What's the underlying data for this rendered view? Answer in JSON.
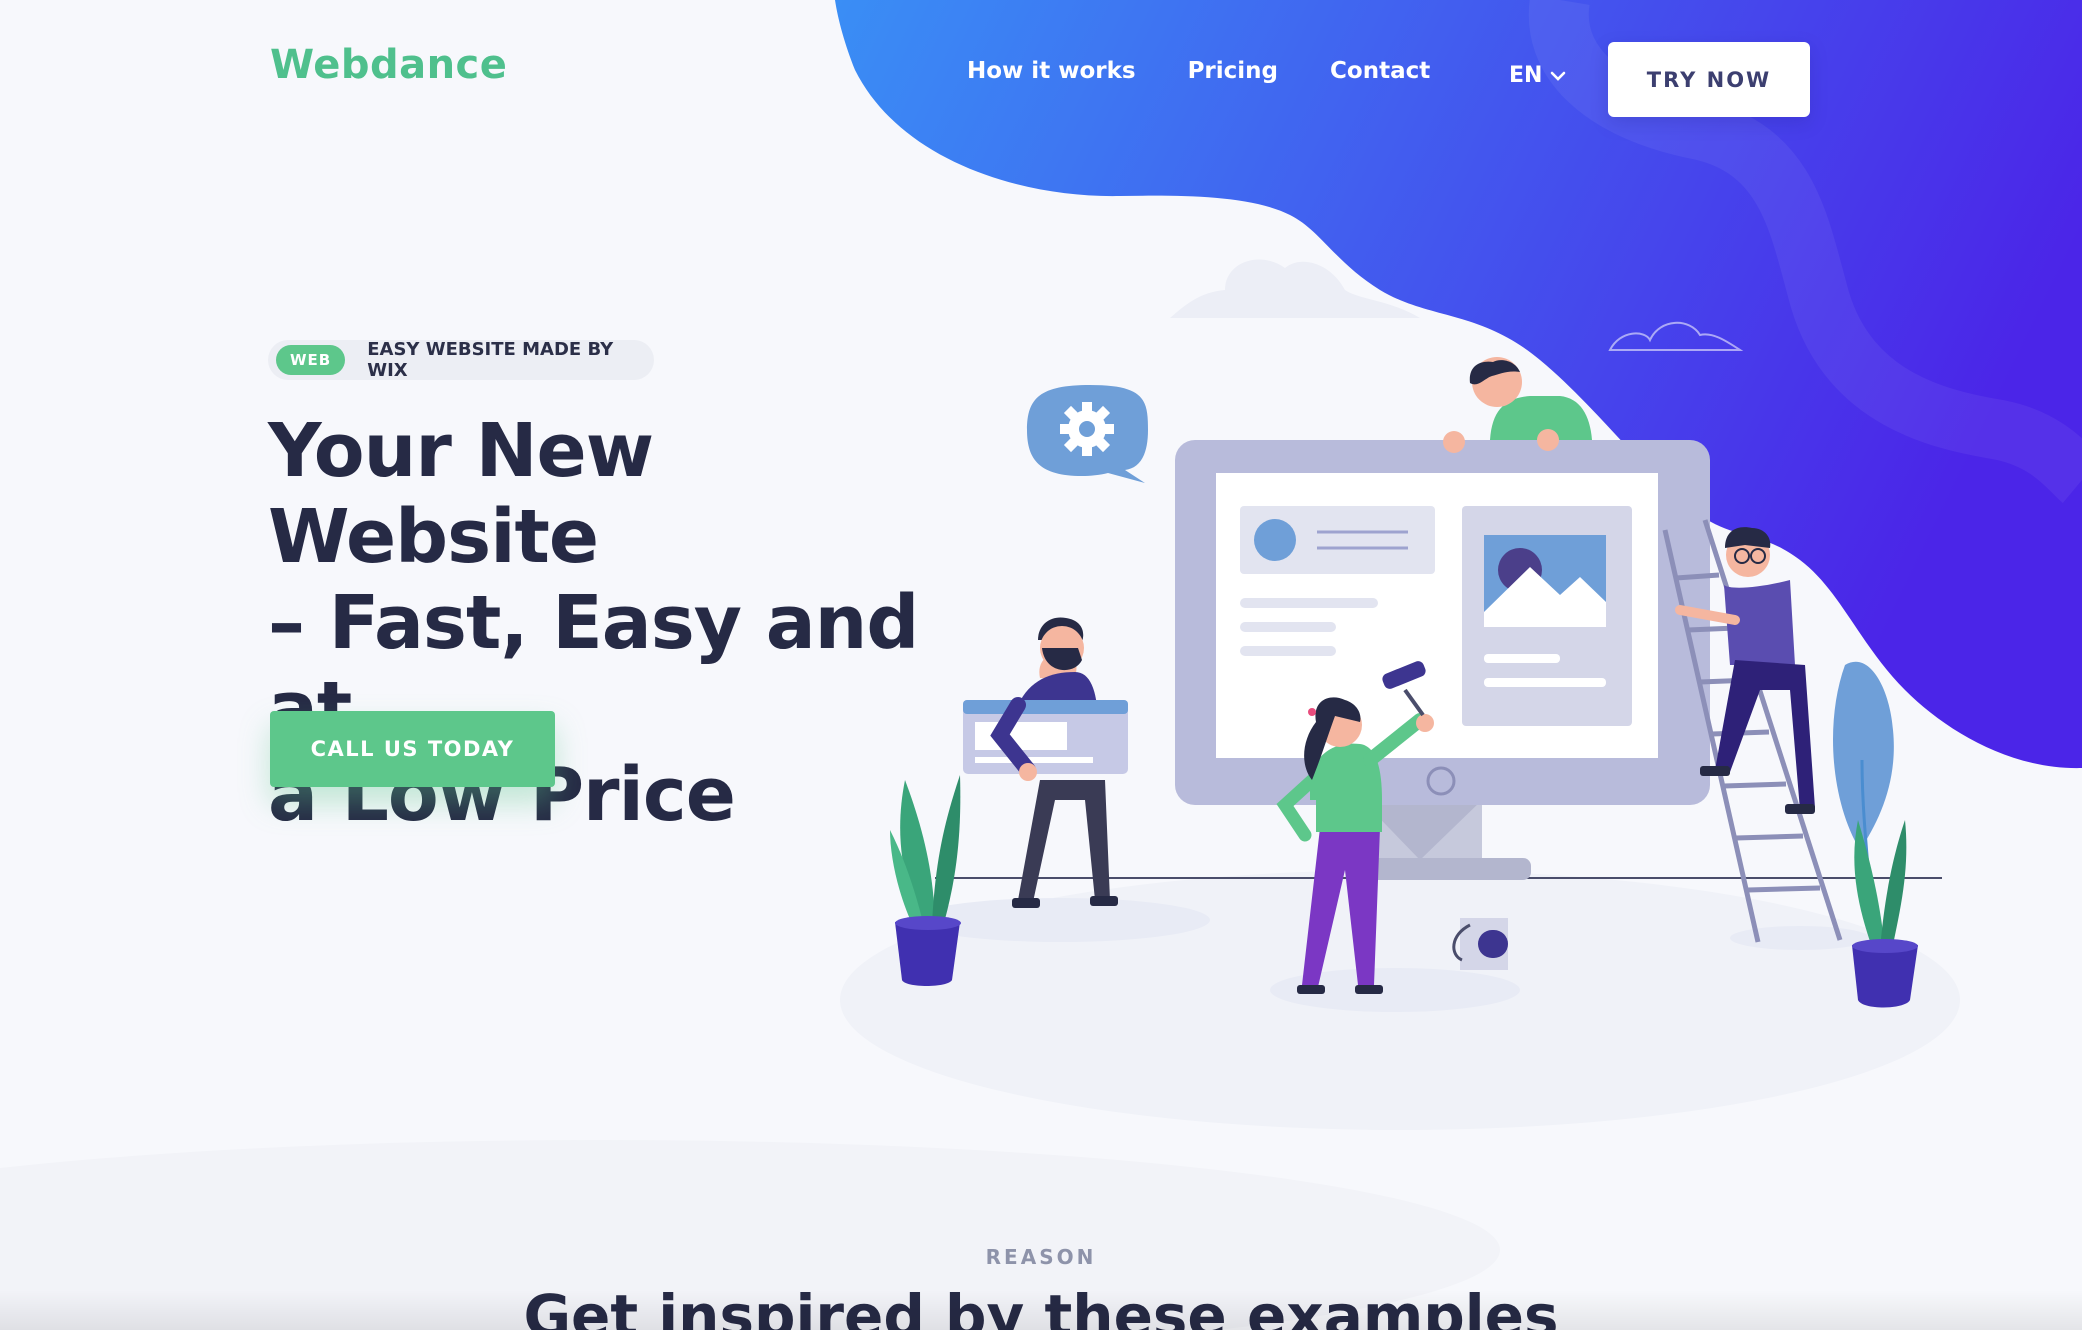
{
  "header": {
    "logo": "Webdance",
    "nav": [
      "How it works",
      "Pricing",
      "Contact"
    ],
    "language": "EN",
    "try_button": "TRY NOW"
  },
  "hero": {
    "tag_pill": "WEB",
    "tag_text": "EASY WEBSITE MADE BY WIX",
    "headline_lines": [
      "Your New Website",
      "– Fast, Easy and at",
      "a Low Price"
    ],
    "cta": "CALL US TODAY"
  },
  "section": {
    "eyebrow": "REASON",
    "title": "Get inspired by these examples"
  },
  "colors": {
    "brand_green": "#5dc78b",
    "logo_green": "#4fc08d",
    "gradient_start": "#3a8ef5",
    "gradient_end": "#4b25e8",
    "heading": "#262a45"
  },
  "icons": [
    "gear-icon",
    "chevron-down-icon",
    "image-icon"
  ]
}
